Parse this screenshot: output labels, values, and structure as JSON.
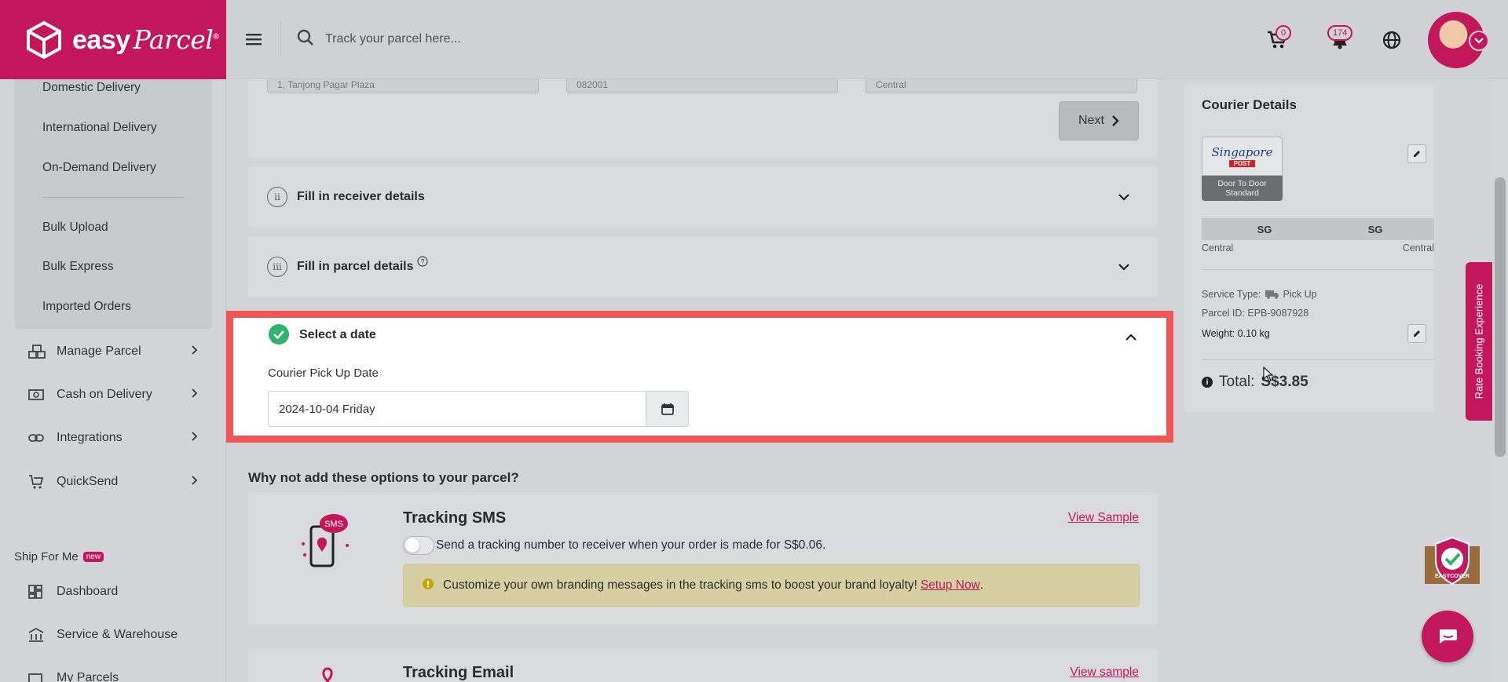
{
  "header": {
    "logo_text": "easy",
    "logo_script": "Parcel",
    "search_placeholder": "Track your parcel here...",
    "cart_count": "0",
    "notification_count": "174"
  },
  "sidebar": {
    "sub_items": [
      "Domestic Delivery",
      "International Delivery",
      "On-Demand Delivery",
      "Bulk Upload",
      "Bulk Express",
      "Imported Orders"
    ],
    "nav_items": [
      "Manage Parcel",
      "Cash on Delivery",
      "Integrations",
      "QuickSend"
    ],
    "ship_for_me": "Ship For Me",
    "new_badge": "new",
    "ship_items": [
      "Dashboard",
      "Service & Warehouse",
      "My Parcels"
    ]
  },
  "steps": {
    "sender_address": "1, Tanjong Pagar Plaza",
    "sender_postcode": "082001",
    "sender_state": "Central",
    "next_label": "Next",
    "receiver": {
      "roman": "ii",
      "title": "Fill in receiver details"
    },
    "parcel": {
      "roman": "iii",
      "title": "Fill in parcel details"
    },
    "date": {
      "title": "Select a date",
      "label": "Courier Pick Up Date",
      "value": "2024-10-04 Friday"
    }
  },
  "options": {
    "heading": "Why not add these options to your parcel?",
    "sms": {
      "title": "Tracking SMS",
      "icon_label": "SMS",
      "view": "View Sample",
      "toggle_text": "Send a tracking number to receiver when your order is made for S$0.06.",
      "notice": "Customize your own branding messages in the tracking sms to boost your brand loyalty!",
      "notice_link": "Setup Now",
      "notice_end": "."
    },
    "email": {
      "title": "Tracking Email",
      "view": "View sample"
    }
  },
  "courier": {
    "title": "Courier Details",
    "logo_text": "Singapore",
    "logo_sub": "POST",
    "service_caption_1": "Door To Door",
    "service_caption_2": "Standard",
    "from_country": "SG",
    "to_country": "SG",
    "from_region": "Central",
    "to_region": "Central",
    "service_type_label": "Service Type:",
    "service_type_value": "Pick Up",
    "parcel_id_label": "Parcel ID:",
    "parcel_id_value": "EPB-9087928",
    "weight_label": "Weight:",
    "weight_value": "0.10 kg",
    "total_label": "Total:",
    "total_value": "S$3.85"
  },
  "rate_tab": "Rate Booking Experience",
  "shield_text": "EASYCOVER",
  "colors": {
    "brand": "#c2185b",
    "highlight": "#f25555",
    "success": "#2fb36b"
  }
}
